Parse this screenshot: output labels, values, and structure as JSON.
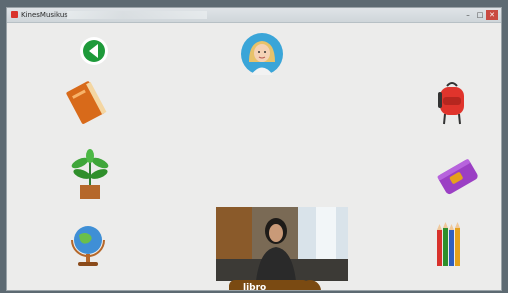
{
  "window": {
    "title": "KinesMusikus"
  },
  "word_label": "libro",
  "icons": {
    "back": "back-arrow-icon",
    "avatar": "girl-avatar-icon",
    "book": "book-icon",
    "backpack": "backpack-icon",
    "plant": "potted-plant-icon",
    "pencil_case": "pencil-case-icon",
    "globe": "globe-icon",
    "colored_pencils": "colored-pencils-icon"
  },
  "colors": {
    "accent_green": "#1e9a3a",
    "label_brown": "#7a4a12",
    "avatar_blue": "#3aa5d8"
  }
}
